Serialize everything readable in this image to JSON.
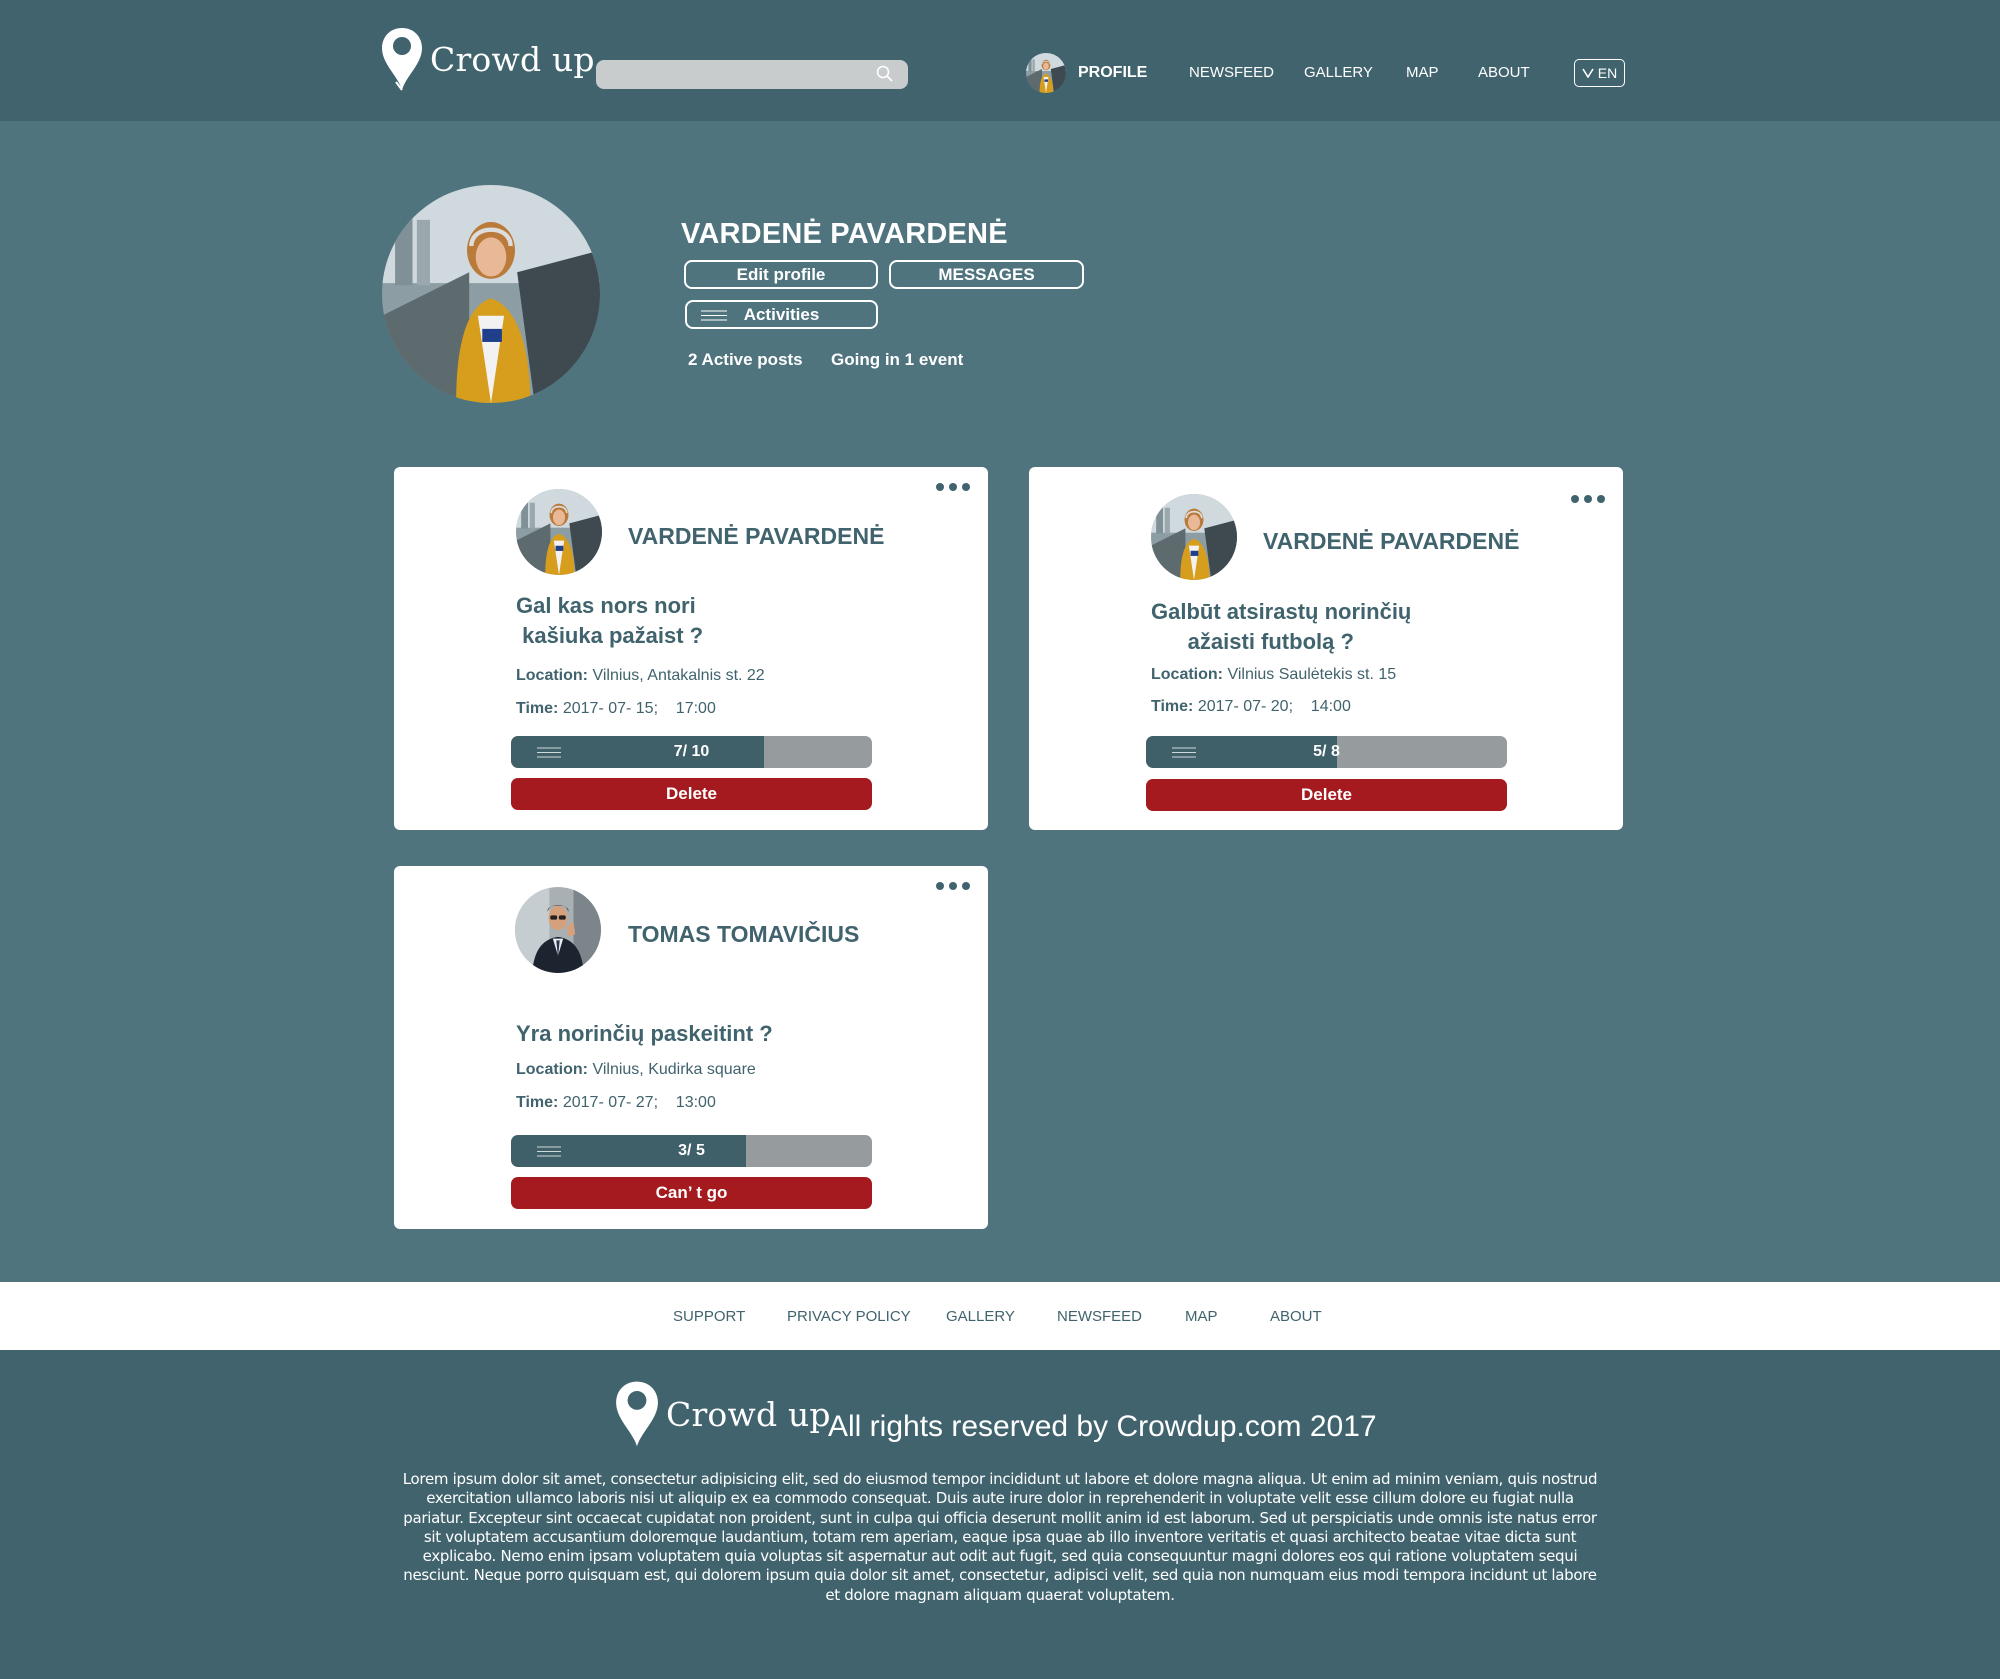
{
  "header": {
    "brand": "Crowd up",
    "search_placeholder": "",
    "nav": {
      "profile": "PROFILE",
      "newsfeed": "NEWSFEED",
      "gallery": "GALLERY",
      "map": "MAP",
      "about": "ABOUT"
    },
    "language": "EN"
  },
  "profile": {
    "name": "VARDENĖ PAVARDENĖ",
    "edit_button": "Edit profile",
    "messages_button": "MESSAGES",
    "activities_button": "Activities",
    "active_posts": "2  Active posts",
    "going": "Going in 1 event"
  },
  "posts": [
    {
      "author": "VARDENĖ PAVARDENĖ",
      "title_line1": "Gal kas nors nori",
      "title_line2": " kašiuka pažaist ?",
      "location_label": "Location:",
      "location": "Vilnius, Antakalnis st. 22",
      "time_label": "Time:",
      "time": "2017- 07- 15;    17:00",
      "count": "7/ 10",
      "progress": 0.7,
      "action": "Delete"
    },
    {
      "author": "VARDENĖ PAVARDENĖ",
      "title_line1": "Galbūt atsirastų norinčių",
      "title_line2": "      ažaisti futbolą ?",
      "location_label": "Location:",
      "location": "Vilnius Saulėtekis st. 15",
      "time_label": "Time:",
      "time": "2017- 07- 20;    14:00",
      "count": "5/ 8",
      "progress": 0.53,
      "action": "Delete"
    },
    {
      "author": "TOMAS TOMAVIČIUS",
      "title_line1": "Yra norinčių paskeitint ?",
      "location_label": "Location:",
      "location": "Vilnius, Kudirka square",
      "time_label": "Time:",
      "time": "2017- 07- 27;    13:00",
      "count": "3/ 5",
      "progress": 0.65,
      "action": "Can’ t go"
    }
  ],
  "footer": {
    "links": {
      "support": "SUPPORT",
      "privacy": "PRIVACY POLICY",
      "gallery": "GALLERY",
      "newsfeed": "NEWSFEED",
      "map": "MAP",
      "about": "ABOUT"
    },
    "brand": "Crowd up",
    "copyright": "All rights reserved by Crowdup.com 2017",
    "body": "Lorem ipsum dolor sit amet, consectetur adipisicing elit, sed do eiusmod tempor incididunt ut labore et dolore magna aliqua. Ut enim ad minim veniam, quis nostrud exercitation ullamco laboris nisi ut aliquip ex ea commodo consequat. Duis aute irure dolor in reprehenderit in voluptate velit esse cillum dolore eu fugiat nulla pariatur. Excepteur sint occaecat cupidatat non proident, sunt in culpa qui officia deserunt mollit anim id est laborum. Sed ut perspiciatis unde omnis iste natus error sit voluptatem accusantium doloremque laudantium, totam rem aperiam, eaque ipsa quae ab illo inventore veritatis et quasi architecto beatae vitae dicta sunt explicabo. Nemo enim ipsam voluptatem quia voluptas sit aspernatur aut odit aut fugit, sed quia consequuntur magni dolores eos qui ratione voluptatem sequi nesciunt. Neque porro quisquam est, qui dolorem ipsum quia dolor sit amet, consectetur, adipisci velit, sed quia non numquam eius modi tempora incidunt ut labore et dolore magnam aliquam quaerat voluptatem."
  },
  "colors": {
    "header_bg": "#40636d",
    "page_bg": "#4f747e",
    "accent_red": "#a41a1e",
    "text_teal": "#40636d",
    "progress_track": "#969c9d"
  }
}
